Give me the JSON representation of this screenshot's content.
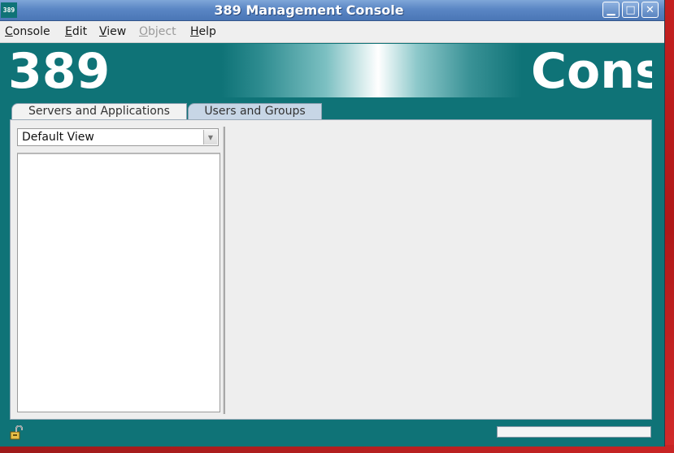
{
  "window": {
    "app_icon_text": "389",
    "title": "389 Management Console",
    "minimize_label": "▁",
    "maximize_label": "□",
    "close_label": "✕"
  },
  "menubar": {
    "items": [
      {
        "label": "Console",
        "mnemonic": "C",
        "rest": "onsole",
        "enabled": true
      },
      {
        "label": "Edit",
        "mnemonic": "E",
        "rest": "dit",
        "enabled": true
      },
      {
        "label": "View",
        "mnemonic": "V",
        "rest": "iew",
        "enabled": true
      },
      {
        "label": "Object",
        "mnemonic": "O",
        "rest": "bject",
        "enabled": false
      },
      {
        "label": "Help",
        "mnemonic": "H",
        "rest": "elp",
        "enabled": true
      }
    ]
  },
  "banner": {
    "left_text": "389",
    "right_text": "Cons"
  },
  "tabs": [
    {
      "label": "Servers and Applications",
      "selected": false
    },
    {
      "label": "Users and Groups",
      "selected": true
    }
  ],
  "view_selector": {
    "value": "Default View",
    "arrow_icon": "chevron-down-icon"
  },
  "statusbar": {
    "lock_icon": "unlocked-padlock-icon",
    "progress": 0
  },
  "colors": {
    "teal": "#0f7377",
    "titlebar": "#5a86c4",
    "desktop_red": "#c42020"
  }
}
